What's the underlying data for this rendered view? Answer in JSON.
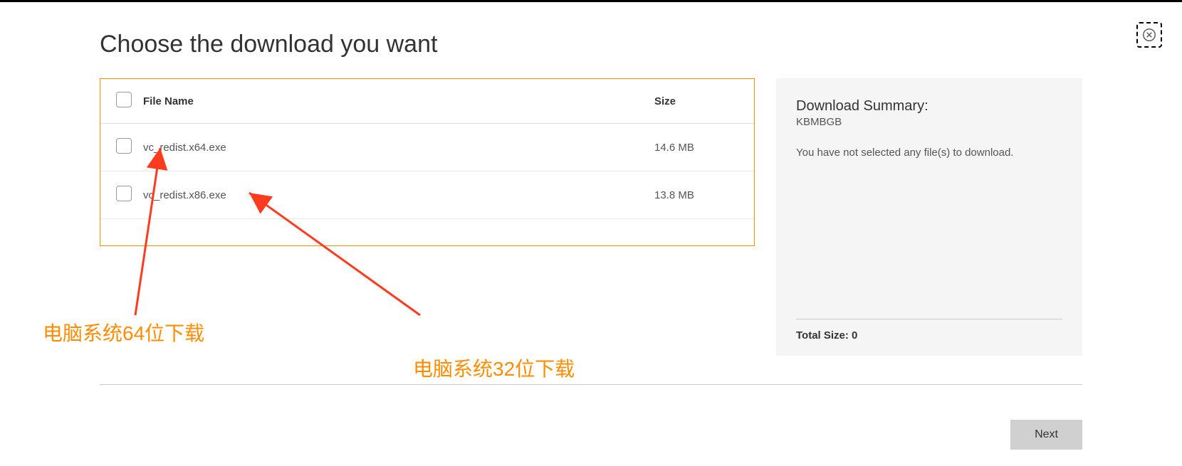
{
  "title": "Choose the download you want",
  "table": {
    "headers": {
      "file_name": "File Name",
      "size": "Size"
    },
    "rows": [
      {
        "name": "vc_redist.x64.exe",
        "size": "14.6 MB"
      },
      {
        "name": "vc_redist.x86.exe",
        "size": "13.8 MB"
      }
    ]
  },
  "summary": {
    "title": "Download Summary:",
    "subtitle": "KBMBGB",
    "message": "You have not selected any file(s) to download.",
    "total_label": "Total Size: 0"
  },
  "next_label": "Next",
  "annotations": {
    "label_64": "电脑系统64位下载",
    "label_32": "电脑系统32位下载"
  }
}
